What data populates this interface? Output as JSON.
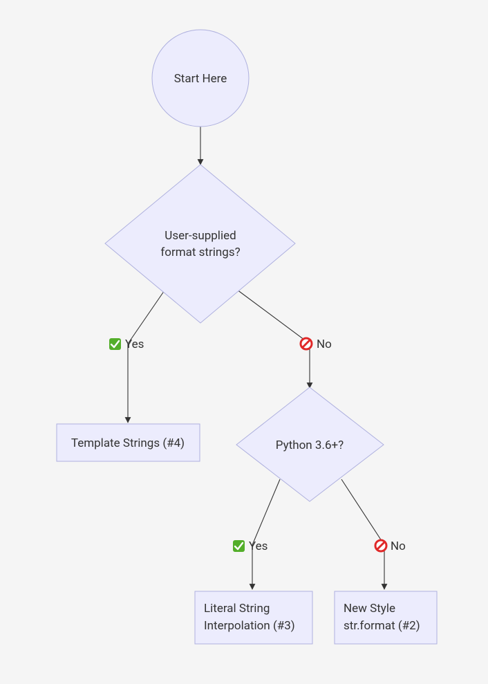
{
  "nodes": {
    "start": {
      "label": "Start Here"
    },
    "q1": {
      "line1": "User-supplied",
      "line2": "format strings?"
    },
    "q2": {
      "label": "Python 3.6+?"
    },
    "r1": {
      "label": "Template Strings (#4)"
    },
    "r2": {
      "line1": "Literal String",
      "line2": "Interpolation (#3)"
    },
    "r3": {
      "line1": "New Style",
      "line2": "str.format (#2)"
    }
  },
  "edges": {
    "yes": "Yes",
    "no": "No"
  },
  "colors": {
    "nodeFill": "#ececfd",
    "nodeStroke": "#aeb0de",
    "edge": "#333333",
    "background": "#f5f5f5",
    "yesIcon": "#53ae2a",
    "noIcon": "#e02828"
  }
}
